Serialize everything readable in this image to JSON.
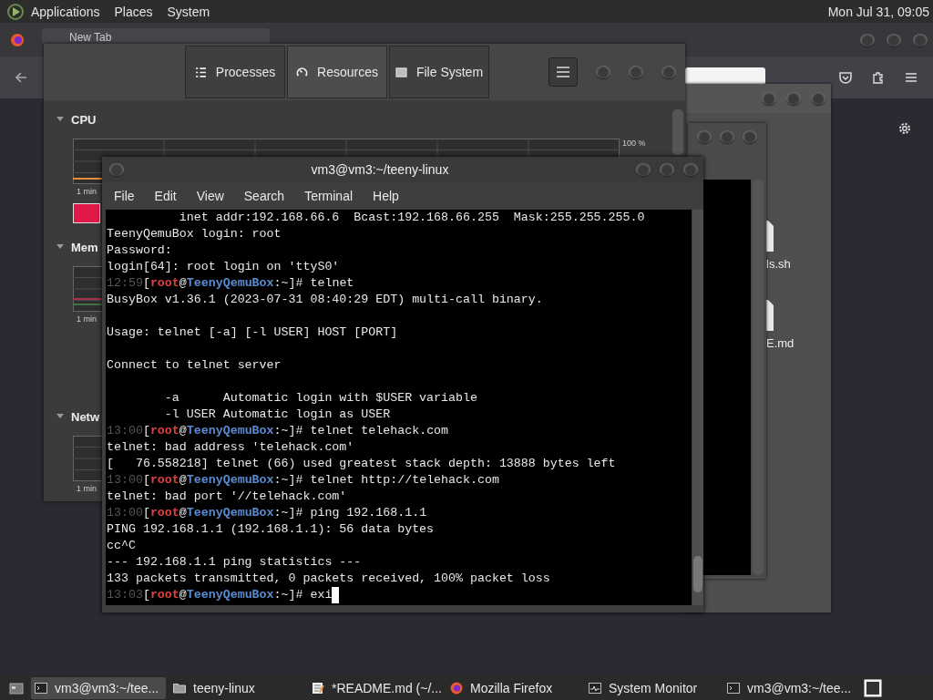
{
  "top_panel": {
    "menus": [
      "Applications",
      "Places",
      "System"
    ],
    "clock": "Mon Jul 31, 09:05"
  },
  "browser": {
    "tab": {
      "label": "New Tab"
    }
  },
  "file_manager": {
    "files": [
      {
        "name": "ls.sh"
      },
      {
        "name": "E.md"
      }
    ]
  },
  "system_monitor": {
    "tabs": [
      {
        "label": "Processes",
        "selected": false,
        "kind": "list"
      },
      {
        "label": "Resources",
        "selected": true,
        "kind": "gauge"
      },
      {
        "label": "File System",
        "selected": false,
        "kind": "disk"
      }
    ],
    "sections": [
      {
        "title": "CPU",
        "expanded": true,
        "scale": "100 %",
        "time_label": "1 min"
      },
      {
        "title": "Mem",
        "expanded": true,
        "time_label": "1 min"
      },
      {
        "title": "Netw",
        "expanded": true,
        "time_label": "1 min"
      }
    ]
  },
  "terminal": {
    "title": "vm3@vm3:~/teeny-linux",
    "menu": [
      "File",
      "Edit",
      "View",
      "Search",
      "Terminal",
      "Help"
    ],
    "lines": [
      {
        "kind": "text",
        "text": "          inet addr:192.168.66.6  Bcast:192.168.66.255  Mask:255.255.255.0"
      },
      {
        "kind": "text",
        "text": "TeenyQemuBox login: root"
      },
      {
        "kind": "text",
        "text": "Password:"
      },
      {
        "kind": "text",
        "text": "login[64]: root login on 'ttyS0'"
      },
      {
        "kind": "prompt",
        "time": "12:59",
        "open": "[",
        "user": "root",
        "at": "@",
        "host": "TeenyQemuBox",
        "close": ":~]#",
        "command": "telnet"
      },
      {
        "kind": "text",
        "text": "BusyBox v1.36.1 (2023-07-31 08:40:29 EDT) multi-call binary."
      },
      {
        "kind": "blank"
      },
      {
        "kind": "text",
        "text": "Usage: telnet [-a] [-l USER] HOST [PORT]"
      },
      {
        "kind": "blank"
      },
      {
        "kind": "text",
        "text": "Connect to telnet server"
      },
      {
        "kind": "blank"
      },
      {
        "kind": "text",
        "text": "        -a      Automatic login with $USER variable"
      },
      {
        "kind": "text",
        "text": "        -l USER Automatic login as USER"
      },
      {
        "kind": "prompt",
        "time": "13:00",
        "open": "[",
        "user": "root",
        "at": "@",
        "host": "TeenyQemuBox",
        "close": ":~]#",
        "command": "telnet telehack.com"
      },
      {
        "kind": "text",
        "text": "telnet: bad address 'telehack.com'"
      },
      {
        "kind": "text",
        "text": "[   76.558218] telnet (66) used greatest stack depth: 13888 bytes left"
      },
      {
        "kind": "prompt",
        "time": "13:00",
        "open": "[",
        "user": "root",
        "at": "@",
        "host": "TeenyQemuBox",
        "close": ":~]#",
        "command": "telnet http://telehack.com"
      },
      {
        "kind": "text",
        "text": "telnet: bad port '//telehack.com'"
      },
      {
        "kind": "prompt",
        "time": "13:00",
        "open": "[",
        "user": "root",
        "at": "@",
        "host": "TeenyQemuBox",
        "close": ":~]#",
        "command": "ping 192.168.1.1"
      },
      {
        "kind": "text",
        "text": "PING 192.168.1.1 (192.168.1.1): 56 data bytes"
      },
      {
        "kind": "text",
        "text": "cc^C"
      },
      {
        "kind": "text",
        "text": "--- 192.168.1.1 ping statistics ---"
      },
      {
        "kind": "text",
        "text": "133 packets transmitted, 0 packets received, 100% packet loss"
      },
      {
        "kind": "prompt",
        "time": "13:03",
        "open": "[",
        "user": "root",
        "at": "@",
        "host": "TeenyQemuBox",
        "close": ":~]#",
        "command": "exi",
        "cursor": true
      }
    ]
  },
  "taskbar": {
    "items": [
      {
        "label": "vm3@vm3:~/tee...",
        "kind": "terminal",
        "selected": true
      },
      {
        "label": "teeny-linux",
        "kind": "folder",
        "selected": false
      },
      {
        "label": "*README.md (~/...",
        "kind": "editor",
        "selected": false
      },
      {
        "label": "Mozilla Firefox",
        "kind": "browser",
        "selected": false
      },
      {
        "label": "System Monitor",
        "kind": "monitor",
        "selected": false
      },
      {
        "label": "vm3@vm3:~/tee...",
        "kind": "terminal",
        "selected": false
      }
    ]
  }
}
